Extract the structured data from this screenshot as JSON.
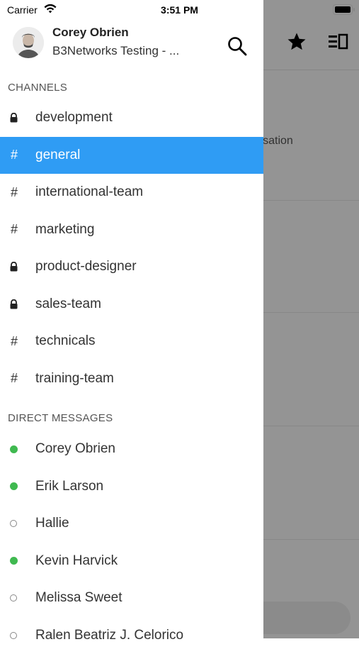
{
  "status_bar": {
    "carrier": "Carrier",
    "time": "3:51 PM"
  },
  "background": {
    "partial_text": "nversation"
  },
  "drawer": {
    "user_name": "Corey Obrien",
    "workspace": "B3Networks Testing - ...",
    "channels_title": "CHANNELS",
    "channels": [
      {
        "name": "development",
        "type": "private"
      },
      {
        "name": "general",
        "type": "public",
        "active": true
      },
      {
        "name": "international-team",
        "type": "public"
      },
      {
        "name": "marketing",
        "type": "public"
      },
      {
        "name": "product-designer",
        "type": "private"
      },
      {
        "name": "sales-team",
        "type": "private"
      },
      {
        "name": "technicals",
        "type": "public"
      },
      {
        "name": "training-team",
        "type": "public"
      }
    ],
    "direct_title": "DIRECT MESSAGES",
    "direct_messages": [
      {
        "name": "Corey Obrien",
        "status": "online"
      },
      {
        "name": "Erik Larson",
        "status": "online"
      },
      {
        "name": "Hallie",
        "status": "offline"
      },
      {
        "name": "Kevin Harvick",
        "status": "online"
      },
      {
        "name": "Melissa Sweet",
        "status": "offline"
      },
      {
        "name": "Ralen Beatriz J. Celorico",
        "status": "offline"
      }
    ],
    "hash_symbol": "#"
  },
  "colors": {
    "accent": "#2f9cf4",
    "online": "#3fb950"
  }
}
